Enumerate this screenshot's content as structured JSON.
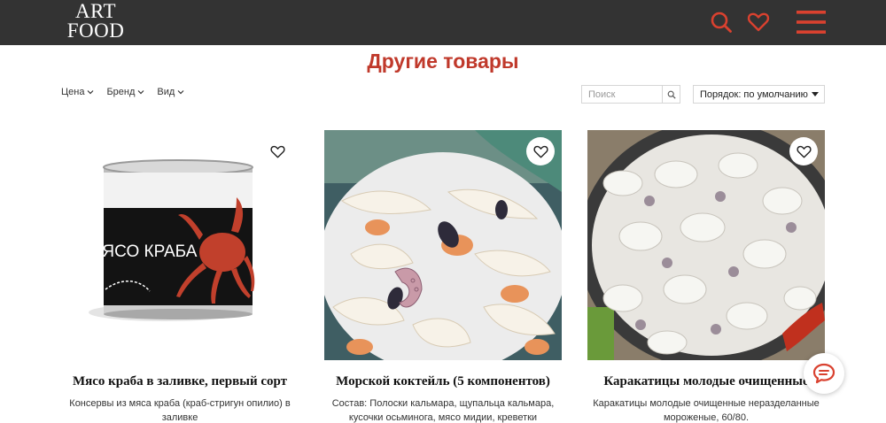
{
  "header": {
    "logo_line1": "ART",
    "logo_line2": "FOOD",
    "icons": [
      "search-icon",
      "heart-icon",
      "menu-icon"
    ],
    "accent_color": "#d9412f",
    "bar_color": "#333333"
  },
  "section": {
    "title": "Другие товары",
    "title_color": "#c0392b"
  },
  "filters": [
    {
      "label": "Цена"
    },
    {
      "label": "Бренд"
    },
    {
      "label": "Вид"
    }
  ],
  "search": {
    "placeholder": "Поиск",
    "value": ""
  },
  "sort": {
    "value": "Порядок: по умолчанию"
  },
  "products": [
    {
      "name": "Мясо краба в заливке, первый сорт",
      "desc_line1": "Консервы из мяса краба (краб-стригун опилио) в",
      "desc_line2": "заливке",
      "image_label": "МЯСО КРАБА"
    },
    {
      "name": "Морской коктейль (5 компонентов)",
      "desc_line1": "Состав: Полоски кальмара, щупальца кальмара,",
      "desc_line2": "кусочки осьминога, мясо мидии, креветки"
    },
    {
      "name": "Каракатицы молодые очищенные",
      "desc_line1": "Каракатицы молодые очищенные неразделанные",
      "desc_line2": "мороженые, 60/80."
    }
  ]
}
